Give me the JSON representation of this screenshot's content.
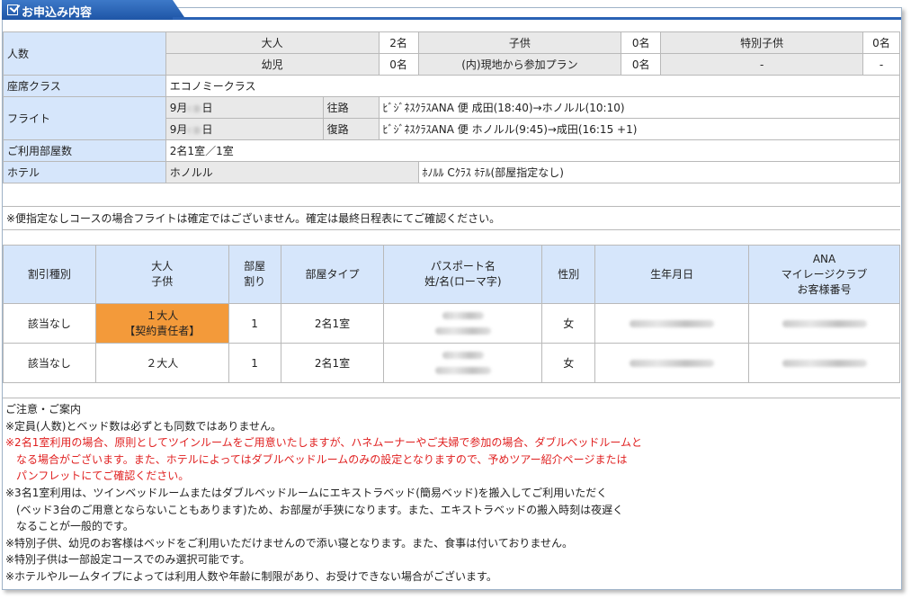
{
  "section_title": "お申込み内容",
  "persons": {
    "label": "人数",
    "row1": [
      {
        "name": "大人",
        "count": "2名"
      },
      {
        "name": "子供",
        "count": "0名"
      },
      {
        "name": "特別子供",
        "count": "0名"
      }
    ],
    "row2": [
      {
        "name": "幼児",
        "count": "0名"
      },
      {
        "name": "(内)現地から参加プラン",
        "count": "0名"
      },
      {
        "name": "-",
        "count": "-"
      }
    ]
  },
  "seat_class": {
    "label": "座席クラス",
    "value": "エコノミークラス"
  },
  "flight": {
    "label": "フライト",
    "legs": [
      {
        "date_prefix": "9月",
        "date_suffix": "日",
        "direction": "往路",
        "detail": "ﾋﾞｼﾞﾈｽｸﾗｽANA 便 成田(18:40)→ホノルル(10:10)"
      },
      {
        "date_prefix": "9月",
        "date_suffix": "日",
        "direction": "復路",
        "detail": "ﾋﾞｼﾞﾈｽｸﾗｽANA 便 ホノルル(9:45)→成田(16:15 +1)"
      }
    ]
  },
  "rooms": {
    "label": "ご利用部屋数",
    "value": "2名1室／1室"
  },
  "hotel": {
    "label": "ホテル",
    "city": "ホノルル",
    "detail": "ﾎﾉﾙﾙ Cｸﾗｽ ﾎﾃﾙ(部屋指定なし)"
  },
  "flight_note": "※便指定なしコースの場合フライトは確定ではございません。確定は最終日程表にてご確認ください。",
  "travelers": {
    "headers": {
      "discount": "割引種別",
      "adult_child_1": "大人",
      "adult_child_2": "子供",
      "room_1": "部屋",
      "room_2": "割り",
      "room_type": "部屋タイプ",
      "passport_1": "パスポート名",
      "passport_2": "姓/名(ローマ字)",
      "gender": "性別",
      "birthdate": "生年月日",
      "mileage_1": "ANA",
      "mileage_2": "マイレージクラブ",
      "mileage_3": "お客様番号"
    },
    "rows": [
      {
        "discount": "該当なし",
        "type_1": "１大人",
        "type_2": "【契約責任者】",
        "room": "1",
        "room_type": "2名1室",
        "gender": "女"
      },
      {
        "discount": "該当なし",
        "type_1": "２大人",
        "type_2": "",
        "room": "1",
        "room_type": "2名1室",
        "gender": "女"
      }
    ]
  },
  "notes": {
    "heading": "ご注意・ご案内",
    "n1": "※定員(人数)とベッド数は必ずとも同数ではありません。",
    "n2a": "※2名1室利用の場合、原則としてツインルームをご用意いたしますが、ハネムーナーやご夫婦で参加の場合、ダブルベッドルームと",
    "n2b": "　なる場合がございます。また、ホテルによってはダブルベッドルームのみの設定となりますので、予めツアー紹介ページまたは",
    "n2c": "　パンフレットにてご確認ください。",
    "n3a": "※3名1室利用は、ツインベッドルームまたはダブルベッドルームにエキストラベッド(簡易ベッド)を搬入してご利用いただく",
    "n3b": "　(ベッド3台のご用意とならないこともあります)ため、お部屋が手狭になります。また、エキストラベッドの搬入時刻は夜遅く",
    "n3c": "　なることが一般的です。",
    "n4": "※特別子供、幼児のお客様はベッドをご利用いただけませんので添い寝となります。また、食事は付いておりません。",
    "n5": "※特別子供は一部設定コースでのみ選択可能です。",
    "n6": "※ホテルやルームタイプによっては利用人数や年齢に制限があり、お受けできない場合がございます。"
  },
  "colors": {
    "header_blue": "#2a62b4",
    "label_bg": "#d6e6fb",
    "highlight_orange": "#f39a3a",
    "warning_red": "#e02020"
  }
}
